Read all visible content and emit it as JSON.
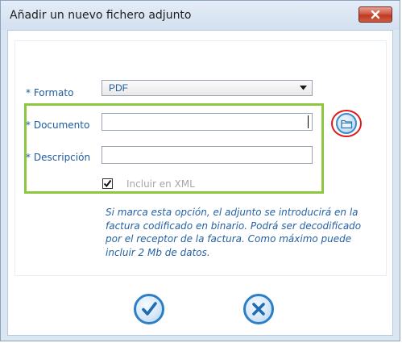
{
  "window": {
    "title": "Añadir un nuevo fichero adjunto"
  },
  "form": {
    "formato": {
      "label": "Formato",
      "required_mark": "*",
      "selected": "PDF"
    },
    "documento": {
      "label": "Documento",
      "required_mark": "*",
      "value": ""
    },
    "descripcion": {
      "label": "Descripción",
      "required_mark": "*",
      "value": ""
    },
    "incluir_xml": {
      "label": "Incluir en XML",
      "checked": true
    },
    "help_text": "Si marca esta opción, el adjunto se introducirá en la factura codificado en binario. Podrá ser decodificado por el receptor de la factura. Como máximo puede incluir 2 Mb de datos."
  },
  "icons": {
    "close": "close-icon",
    "dropdown": "chevron-down-icon",
    "browse": "folder-icon",
    "accept": "checkmark-icon",
    "cancel": "x-icon"
  },
  "colors": {
    "label_blue": "#1d5a9e",
    "highlight_green": "#8dc63f",
    "highlight_red": "#e01818",
    "close_red": "#c03a24",
    "button_blue": "#2c7ec6"
  }
}
